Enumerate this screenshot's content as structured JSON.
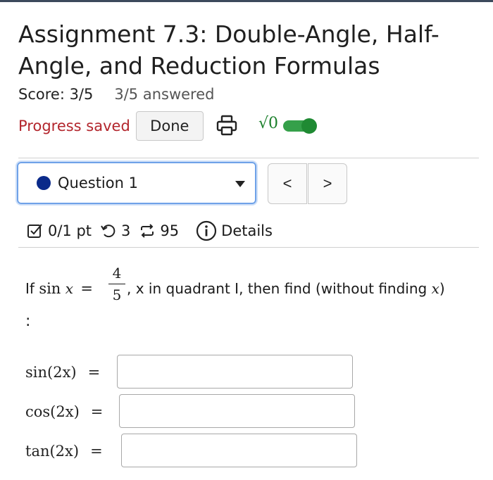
{
  "assignment": {
    "title": "Assignment 7.3: Double-Angle, Half-Angle, and Reduction Formulas",
    "score": "Score: 3/5",
    "answered": "3/5 answered"
  },
  "toolbar": {
    "progress_text": "Progress saved",
    "done_label": "Done",
    "print_icon": "printer-icon",
    "math_toggle_label": "√0",
    "math_toggle_on": true,
    "accent_green": "#35a04a"
  },
  "question_nav": {
    "selected": "Question 1",
    "prev_label": "<",
    "next_label": ">",
    "status_dot_color": "#0a2a8a"
  },
  "question_meta": {
    "points": "0/1 pt",
    "retries": "3",
    "attempts": "95",
    "details_label": "Details"
  },
  "problem": {
    "prefix": "If",
    "func": "sin",
    "var": "x",
    "eq": "=",
    "numerator": "4",
    "denominator": "5",
    "comma": ",",
    "rest_pre": " x in quadrant I, then find (without finding ",
    "rest_var": "x",
    "rest_post": ")",
    "colon": ":"
  },
  "answers": [
    {
      "label": "sin(2x)",
      "sign": "=",
      "value": ""
    },
    {
      "label": "cos(2x)",
      "sign": "=",
      "value": ""
    },
    {
      "label": "tan(2x)",
      "sign": "=",
      "value": ""
    }
  ]
}
